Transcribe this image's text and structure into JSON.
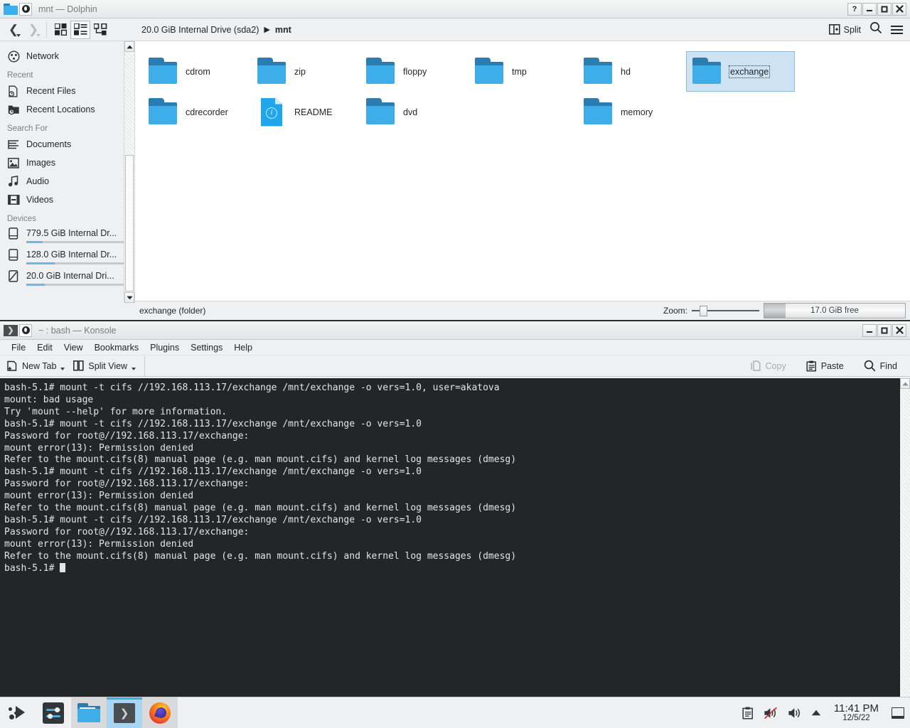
{
  "dolphin": {
    "title": "mnt — Dolphin",
    "titlebar_icons": [
      "folder-icon",
      "kde-badge-icon"
    ],
    "window_buttons": [
      {
        "name": "help-button",
        "glyph": "?"
      },
      {
        "name": "minimize-button",
        "glyph": "—"
      },
      {
        "name": "maximize-button",
        "glyph": "□"
      },
      {
        "name": "close-button",
        "glyph": "✕"
      }
    ],
    "toolbar": {
      "back_label": "Back",
      "forward_label": "Forward",
      "view_modes": [
        {
          "name": "icons-view-button",
          "label": "Icons",
          "active": false
        },
        {
          "name": "compact-view-button",
          "label": "Compact",
          "active": true
        },
        {
          "name": "details-view-button",
          "label": "Details",
          "active": false
        }
      ],
      "split_label": "Split",
      "search_label": "Search",
      "menu_label": "Menu"
    },
    "breadcrumb": {
      "root": "20.0 GiB Internal Drive (sda2)",
      "separator": "▶",
      "current": "mnt"
    },
    "sidebar": {
      "top_items": [
        {
          "label": "Network",
          "icon": "network-icon"
        }
      ],
      "sections": [
        {
          "header": "Recent",
          "items": [
            {
              "label": "Recent Files",
              "icon": "recent-files-icon"
            },
            {
              "label": "Recent Locations",
              "icon": "recent-locations-icon"
            }
          ]
        },
        {
          "header": "Search For",
          "items": [
            {
              "label": "Documents",
              "icon": "documents-icon"
            },
            {
              "label": "Images",
              "icon": "images-icon"
            },
            {
              "label": "Audio",
              "icon": "audio-icon"
            },
            {
              "label": "Videos",
              "icon": "videos-icon"
            }
          ]
        }
      ],
      "devices_header": "Devices",
      "devices": [
        {
          "label": "779.5 GiB Internal Dr...",
          "icon": "harddisk-icon",
          "used_percent": 16
        },
        {
          "label": "128.0 GiB Internal Dr...",
          "icon": "harddisk-icon",
          "used_percent": 28
        },
        {
          "label": "20.0 GiB Internal Dri...",
          "icon": "harddisk-mounted-icon",
          "used_percent": 18
        }
      ]
    },
    "files": [
      {
        "name": "cdrom",
        "type": "folder",
        "selected": false
      },
      {
        "name": "zip",
        "type": "folder",
        "selected": false
      },
      {
        "name": "floppy",
        "type": "folder",
        "selected": false
      },
      {
        "name": "tmp",
        "type": "folder",
        "selected": false
      },
      {
        "name": "hd",
        "type": "folder",
        "selected": false
      },
      {
        "name": "exchange",
        "type": "folder",
        "selected": true
      },
      {
        "name": "cdrecorder",
        "type": "folder",
        "selected": false
      },
      {
        "name": "README",
        "type": "document",
        "selected": false
      },
      {
        "name": "dvd",
        "type": "folder",
        "selected": false
      },
      {
        "name": "",
        "type": "empty",
        "selected": false
      },
      {
        "name": "memory",
        "type": "folder",
        "selected": false
      }
    ],
    "statusbar": {
      "selection_text": "exchange (folder)",
      "zoom_label": "Zoom:",
      "zoom_value": 12,
      "free_space_text": "17.0 GiB free",
      "used_percent": 15
    },
    "colors": {
      "accent": "#3daee9",
      "selection_bg": "#cde3f4",
      "selection_border": "#8fb9d9",
      "folder": "#3daee9",
      "folder_dark": "#2b7cb0"
    }
  },
  "konsole": {
    "title": "~ : bash — Konsole",
    "window_buttons": [
      {
        "name": "minimize-button",
        "glyph": "—"
      },
      {
        "name": "maximize-button",
        "glyph": "□"
      },
      {
        "name": "close-button",
        "glyph": "✕"
      }
    ],
    "menubar": [
      "File",
      "Edit",
      "View",
      "Bookmarks",
      "Plugins",
      "Settings",
      "Help"
    ],
    "toolbar": {
      "new_tab_label": "New Tab",
      "split_view_label": "Split View",
      "copy_label": "Copy",
      "copy_disabled": true,
      "paste_label": "Paste",
      "find_label": "Find"
    },
    "terminal": {
      "background": "#232627",
      "foreground": "#e3e4e5",
      "lines": [
        "bash-5.1# mount -t cifs //192.168.113.17/exchange /mnt/exchange -o vers=1.0, user=akatova",
        "mount: bad usage",
        "Try 'mount --help' for more information.",
        "bash-5.1# mount -t cifs //192.168.113.17/exchange /mnt/exchange -o vers=1.0",
        "Password for root@//192.168.113.17/exchange:",
        "mount error(13): Permission denied",
        "Refer to the mount.cifs(8) manual page (e.g. man mount.cifs) and kernel log messages (dmesg)",
        "bash-5.1# mount -t cifs //192.168.113.17/exchange /mnt/exchange -o vers=1.0",
        "Password for root@//192.168.113.17/exchange:",
        "mount error(13): Permission denied",
        "Refer to the mount.cifs(8) manual page (e.g. man mount.cifs) and kernel log messages (dmesg)",
        "bash-5.1# mount -t cifs //192.168.113.17/exchange /mnt/exchange -o vers=1.0",
        "Password for root@//192.168.113.17/exchange:",
        "mount error(13): Permission denied",
        "Refer to the mount.cifs(8) manual page (e.g. man mount.cifs) and kernel log messages (dmesg)"
      ],
      "prompt": "bash-5.1# "
    }
  },
  "taskbar": {
    "launcher": {
      "name": "application-launcher",
      "label": "Application Launcher"
    },
    "pinned": [
      {
        "name": "taskbar-settings",
        "label": "System Settings",
        "state": "pinned"
      }
    ],
    "windows": [
      {
        "name": "taskbar-dolphin",
        "label": "Dolphin",
        "active": false
      },
      {
        "name": "taskbar-konsole",
        "label": "Konsole",
        "active": true
      },
      {
        "name": "taskbar-firefox",
        "label": "Firefox",
        "active": false
      }
    ],
    "tray": [
      {
        "name": "clipboard-icon",
        "label": "Clipboard"
      },
      {
        "name": "volume-muted-icon",
        "label": "Audio Muted"
      },
      {
        "name": "volume-icon",
        "label": "Volume"
      },
      {
        "name": "show-hidden-icons-arrow",
        "label": "Show hidden icons"
      }
    ],
    "clock": {
      "time": "11:41 PM",
      "date": "12/5/22"
    },
    "show_desktop": {
      "name": "show-desktop-button",
      "label": "Show Desktop"
    }
  }
}
